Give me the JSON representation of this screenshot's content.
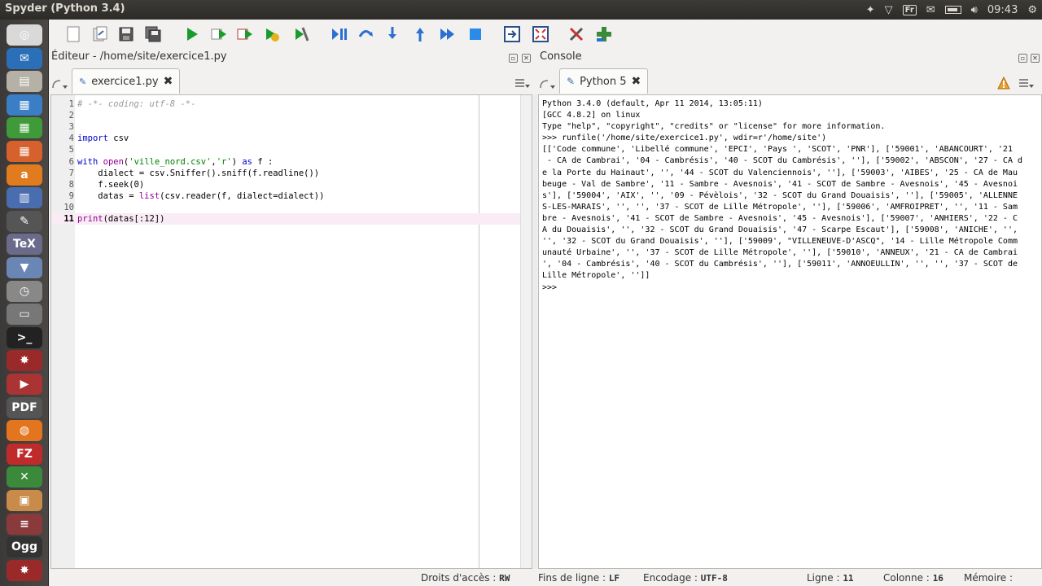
{
  "window": {
    "title": "Spyder (Python 3.4)"
  },
  "system_tray": {
    "keyboard_layout": "Fr",
    "clock": "09:43"
  },
  "launcher": {
    "items": [
      {
        "name": "ubuntu-dash-icon",
        "glyph": "◎",
        "color": "#d9d9d9"
      },
      {
        "name": "thunderbird-icon",
        "glyph": "✉",
        "color": "#2a6fb8"
      },
      {
        "name": "files-icon",
        "glyph": "▤",
        "color": "#b6b1a6"
      },
      {
        "name": "writer-icon",
        "glyph": "▦",
        "color": "#3a7fc6"
      },
      {
        "name": "calc-icon",
        "glyph": "▦",
        "color": "#3f9a3a"
      },
      {
        "name": "impress-icon",
        "glyph": "▦",
        "color": "#d6612c"
      },
      {
        "name": "amazon-icon",
        "glyph": "a",
        "color": "#e07b1f"
      },
      {
        "name": "books-icon",
        "glyph": "▥",
        "color": "#4a6db0"
      },
      {
        "name": "pencil-icon",
        "glyph": "✎",
        "color": "#555"
      },
      {
        "name": "texmaker-icon",
        "glyph": "TeX",
        "color": "#6a6a8a"
      },
      {
        "name": "installer-icon",
        "glyph": "▼",
        "color": "#6a86b5"
      },
      {
        "name": "clock-icon",
        "glyph": "◷",
        "color": "#888"
      },
      {
        "name": "scanner-icon",
        "glyph": "▭",
        "color": "#777"
      },
      {
        "name": "terminal-icon",
        "glyph": ">_",
        "color": "#222"
      },
      {
        "name": "spyder-icon",
        "glyph": "✸",
        "color": "#9a2a2a"
      },
      {
        "name": "video-downloader-icon",
        "glyph": "▶",
        "color": "#a33"
      },
      {
        "name": "pdf-shuffler-icon",
        "glyph": "PDF",
        "color": "#555"
      },
      {
        "name": "firefox-icon",
        "glyph": "◍",
        "color": "#e4751f"
      },
      {
        "name": "filezilla-icon",
        "glyph": "FZ",
        "color": "#bf2b2b"
      },
      {
        "name": "bitmap-icon",
        "glyph": "✕",
        "color": "#3b8a3b"
      },
      {
        "name": "photo-icon",
        "glyph": "▣",
        "color": "#c88b4a"
      },
      {
        "name": "layers-icon",
        "glyph": "≡",
        "color": "#8a3a3a"
      },
      {
        "name": "ogg-icon",
        "glyph": "Ogg",
        "color": "#333"
      },
      {
        "name": "gear-red-icon",
        "glyph": "✸",
        "color": "#9a2a2a"
      }
    ]
  },
  "editor": {
    "pane_title": "Éditeur - /home/site/exercice1.py",
    "tab_label": "exercice1.py",
    "lines": [
      {
        "n": "1",
        "parts": [
          {
            "t": "# -*- coding: utf-8 -*-",
            "c": "cmt"
          }
        ]
      },
      {
        "n": "2",
        "parts": []
      },
      {
        "n": "3",
        "parts": []
      },
      {
        "n": "4",
        "parts": [
          {
            "t": "import",
            "c": "kw"
          },
          {
            "t": " csv",
            "c": ""
          }
        ]
      },
      {
        "n": "5",
        "parts": []
      },
      {
        "n": "6",
        "parts": [
          {
            "t": "with",
            "c": "kw"
          },
          {
            "t": " ",
            "c": ""
          },
          {
            "t": "open",
            "c": "bi"
          },
          {
            "t": "(",
            "c": ""
          },
          {
            "t": "'ville_nord.csv'",
            "c": "str"
          },
          {
            "t": ",",
            "c": ""
          },
          {
            "t": "'r'",
            "c": "str"
          },
          {
            "t": ") ",
            "c": ""
          },
          {
            "t": "as",
            "c": "kw"
          },
          {
            "t": " f :",
            "c": ""
          }
        ]
      },
      {
        "n": "7",
        "parts": [
          {
            "t": "    dialect = csv.Sniffer().sniff(f.readline())",
            "c": ""
          }
        ]
      },
      {
        "n": "8",
        "parts": [
          {
            "t": "    f.seek(0)",
            "c": ""
          }
        ]
      },
      {
        "n": "9",
        "parts": [
          {
            "t": "    datas = ",
            "c": ""
          },
          {
            "t": "list",
            "c": "bi"
          },
          {
            "t": "(csv.reader(f, dialect=dialect))",
            "c": ""
          }
        ]
      },
      {
        "n": "10",
        "parts": []
      },
      {
        "n": "11",
        "parts": [
          {
            "t": "print",
            "c": "bi"
          },
          {
            "t": "(datas[:12])",
            "c": ""
          }
        ]
      }
    ],
    "current_line": "11"
  },
  "console": {
    "pane_title": "Console",
    "tab_label": "Python 5",
    "output": [
      "Python 3.4.0 (default, Apr 11 2014, 13:05:11)",
      "[GCC 4.8.2] on linux",
      "Type \"help\", \"copyright\", \"credits\" or \"license\" for more information.",
      ">>> runfile('/home/site/exercice1.py', wdir=r'/home/site')",
      "[['Code commune', 'Libellé commune', 'EPCI', 'Pays ', 'SCOT', 'PNR'], ['59001', 'ABANCOURT', '21 ",
      " - CA de Cambrai', '04 - Cambrésis', '40 - SCOT du Cambrésis', ''], ['59002', 'ABSCON', '27 - CA d",
      "e la Porte du Hainaut', '', '44 - SCOT du Valenciennois', ''], ['59003', 'AIBES', '25 - CA de Mau",
      "beuge - Val de Sambre', '11 - Sambre - Avesnois', '41 - SCOT de Sambre - Avesnois', '45 - Avesnoi",
      "s'], ['59004', 'AIX', '', '09 - Pévèlois', '32 - SCOT du Grand Douaisis', ''], ['59005', 'ALLENNE",
      "S-LES-MARAIS', '', '', '37 - SCOT de Lille Métropole', ''], ['59006', 'AMFROIPRET', '', '11 - Sam",
      "bre - Avesnois', '41 - SCOT de Sambre - Avesnois', '45 - Avesnois'], ['59007', 'ANHIERS', '22 - C",
      "A du Douaisis', '', '32 - SCOT du Grand Douaisis', '47 - Scarpe Escaut'], ['59008', 'ANICHE', '',",
      "'', '32 - SCOT du Grand Douaisis', ''], ['59009', \"VILLENEUVE-D'ASCQ\", '14 - Lille Métropole Comm",
      "unauté Urbaine', '', '37 - SCOT de Lille Métropole', ''], ['59010', 'ANNEUX', '21 - CA de Cambrai",
      "', '04 - Cambrésis', '40 - SCOT du Cambrésis', ''], ['59011', 'ANNOEULLIN', '', '', '37 - SCOT de",
      "Lille Métropole', '']]",
      ">>> "
    ]
  },
  "statusbar": {
    "access_label": "Droits d'accès :",
    "access_value": "RW",
    "eol_label": "Fins de ligne :",
    "eol_value": "LF",
    "encoding_label": "Encodage :",
    "encoding_value": "UTF-8",
    "line_label": "Ligne :",
    "line_value": "11",
    "column_label": "Colonne :",
    "column_value": "16",
    "memory_label": "Mémoire :"
  }
}
